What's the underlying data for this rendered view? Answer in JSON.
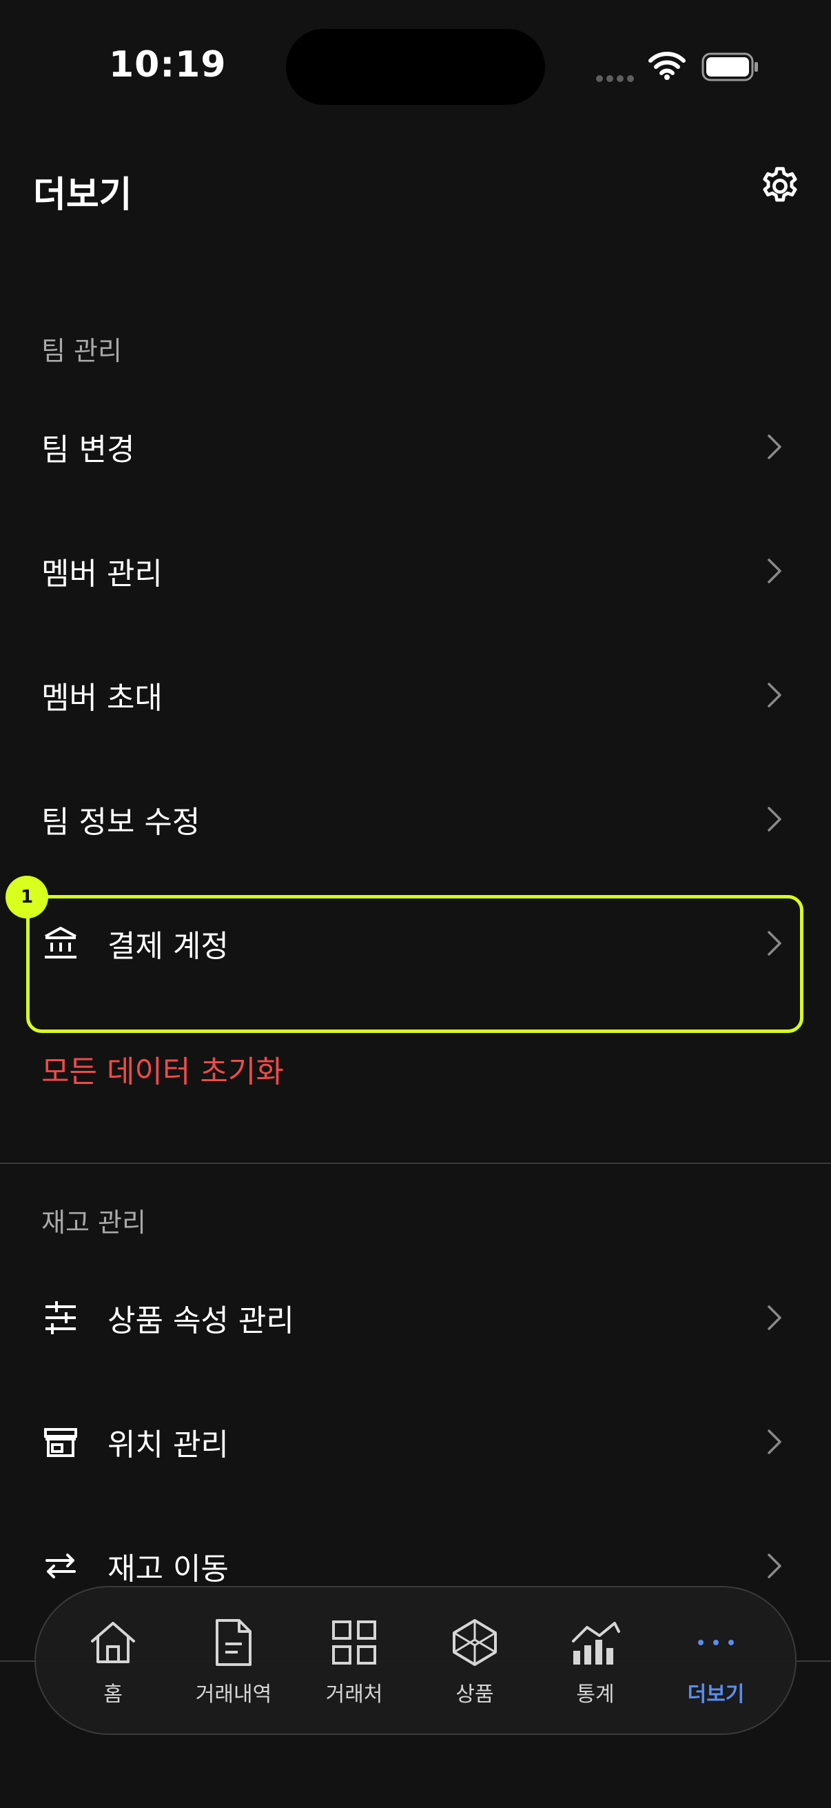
{
  "status_bar": {
    "time": "10:19"
  },
  "header": {
    "title": "더보기"
  },
  "team_section": {
    "title": "팀 관리",
    "items": [
      {
        "label": "팀 변경"
      },
      {
        "label": "멤버 관리"
      },
      {
        "label": "멤버 초대"
      },
      {
        "label": "팀 정보 수정"
      },
      {
        "label": "결제 계정",
        "icon": "bank-icon"
      }
    ],
    "reset_label": "모든 데이터 초기화"
  },
  "highlight_badge": "1",
  "inventory_section": {
    "title": "재고 관리",
    "items": [
      {
        "label": "상품 속성 관리",
        "icon": "sliders-icon"
      },
      {
        "label": "위치 관리",
        "icon": "store-icon"
      },
      {
        "label": "재고 이동",
        "icon": "transfer-icon"
      }
    ]
  },
  "tab_bar": {
    "active_color": "#5b8def",
    "tabs": [
      {
        "label": "홈",
        "icon": "home-icon"
      },
      {
        "label": "거래내역",
        "icon": "document-icon"
      },
      {
        "label": "거래처",
        "icon": "grid-icon"
      },
      {
        "label": "상품",
        "icon": "cube-icon"
      },
      {
        "label": "통계",
        "icon": "chart-icon"
      },
      {
        "label": "더보기",
        "icon": "more-icon"
      }
    ]
  },
  "accent_color": "#d8ff1e",
  "danger_color": "#f04a4a"
}
